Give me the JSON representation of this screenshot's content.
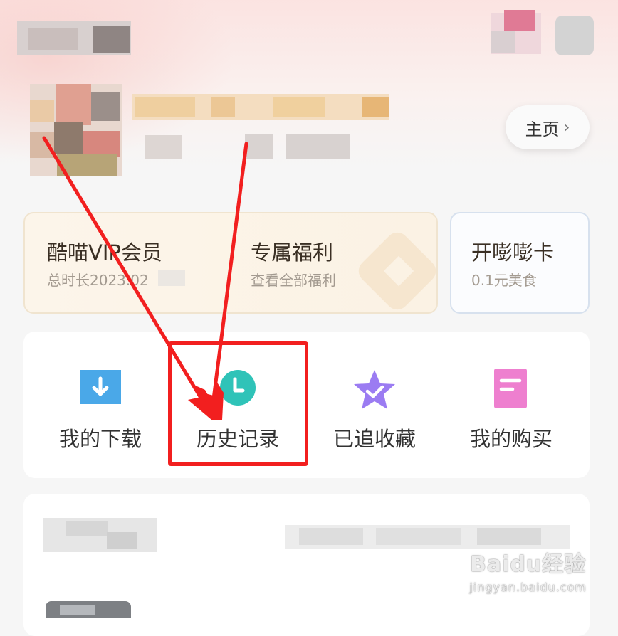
{
  "header": {
    "home_label": "主页",
    "home_chevron": "›"
  },
  "vip_card": {
    "title": "酷喵VIP会员",
    "subtitle": "总时长2023.02",
    "benefit_title": "专属福利",
    "benefit_subtitle": "查看全部福利"
  },
  "food_card": {
    "title": "开嘭嘭卡",
    "subtitle": "0.1元美食"
  },
  "entries": [
    {
      "label": "我的下载",
      "icon": "download-icon",
      "color": "#4aa8e8"
    },
    {
      "label": "历史记录",
      "icon": "history-clock-icon",
      "color": "#2fc3b8"
    },
    {
      "label": "已追收藏",
      "icon": "star-favorite-icon",
      "color": "#9b7cf2"
    },
    {
      "label": "我的购买",
      "icon": "purchase-document-icon",
      "color": "#ee7fcf"
    }
  ],
  "annotation": {
    "color": "#f21f1f"
  },
  "watermark": {
    "main": "Baidu经验",
    "sub": "jingyan.baidu.com"
  }
}
